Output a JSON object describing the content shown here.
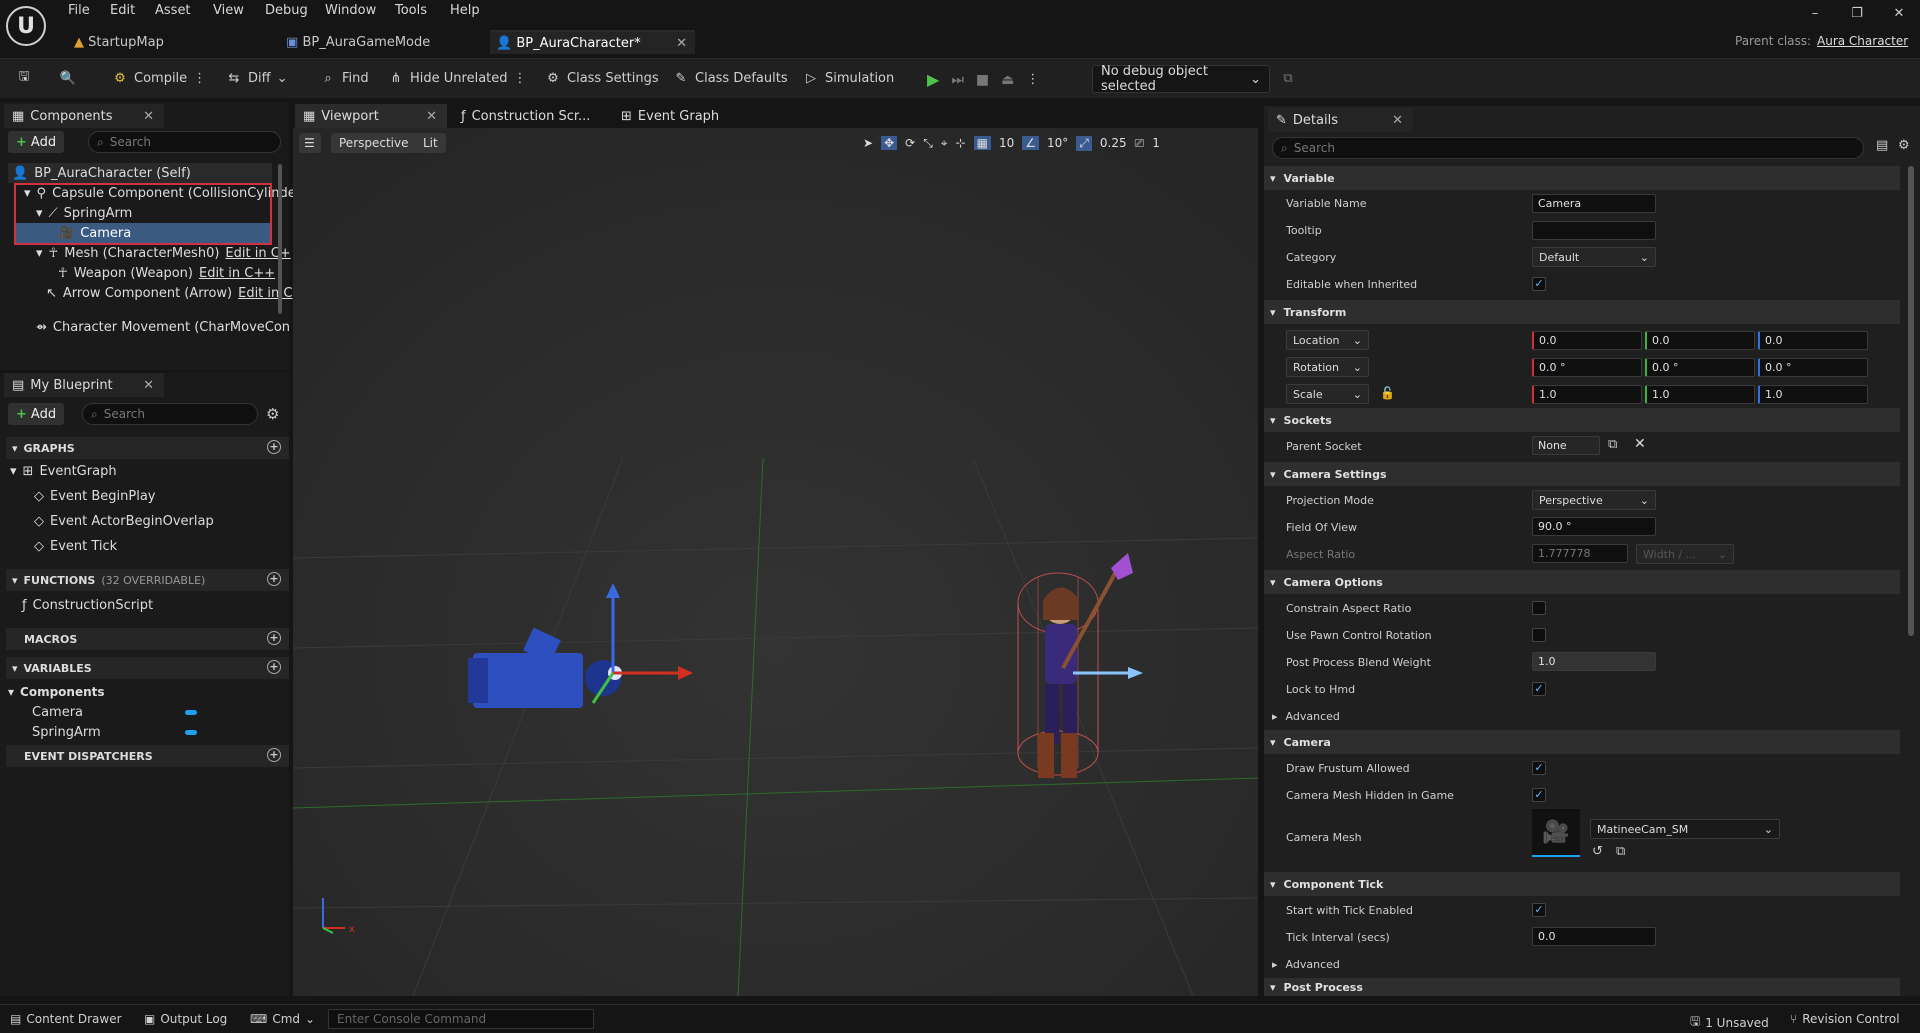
{
  "menu": [
    "File",
    "Edit",
    "Asset",
    "View",
    "Debug",
    "Window",
    "Tools",
    "Help"
  ],
  "doc_tabs": [
    {
      "label": "StartupMap",
      "active": false
    },
    {
      "label": "BP_AuraGameMode",
      "active": false
    },
    {
      "label": "BP_AuraCharacter*",
      "active": true
    }
  ],
  "parent_class": {
    "label": "Parent class:",
    "value": "Aura Character"
  },
  "window_buttons": [
    "–",
    "❐",
    "✕"
  ],
  "toolbar": {
    "compile": "Compile",
    "diff": "Diff",
    "find": "Find",
    "hide_unrelated": "Hide Unrelated",
    "class_settings": "Class Settings",
    "class_defaults": "Class Defaults",
    "simulation": "Simulation",
    "debug_object": "No debug object selected"
  },
  "components_panel": {
    "tab": "Components",
    "add": "Add",
    "search_placeholder": "Search",
    "tree": [
      {
        "label": "BP_AuraCharacter (Self)",
        "edit": ""
      },
      {
        "label": "Capsule Component (CollisionCylinde",
        "edit": ""
      },
      {
        "label": "SpringArm",
        "edit": ""
      },
      {
        "label": "Camera",
        "edit": ""
      },
      {
        "label": "Mesh (CharacterMesh0)",
        "edit": "Edit in C+"
      },
      {
        "label": "Weapon (Weapon)",
        "edit": "Edit in C++"
      },
      {
        "label": "Arrow Component (Arrow)",
        "edit": "Edit in C"
      },
      {
        "label": "Character Movement (CharMoveCon",
        "edit": ""
      }
    ]
  },
  "my_blueprint": {
    "tab": "My Blueprint",
    "add": "Add",
    "search_placeholder": "Search",
    "graphs_header": "GRAPHS",
    "event_graph": "EventGraph",
    "events": [
      "Event BeginPlay",
      "Event ActorBeginOverlap",
      "Event Tick"
    ],
    "functions_header": "FUNCTIONS",
    "functions_note": "(32 OVERRIDABLE)",
    "construction_script": "ConstructionScript",
    "macros_header": "MACROS",
    "variables_header": "VARIABLES",
    "components_group": "Components",
    "variables": [
      "Camera",
      "SpringArm"
    ],
    "event_dispatchers_header": "EVENT DISPATCHERS"
  },
  "editor_tabs": {
    "viewport": "Viewport",
    "construction": "Construction Scr...",
    "event_graph": "Event Graph"
  },
  "viewport": {
    "perspective": "Perspective",
    "lit": "Lit",
    "grid_snap": "10",
    "rot_snap": "10°",
    "scale_snap": "0.25",
    "cam_speed": "1",
    "axis_x": "x"
  },
  "details": {
    "tab": "Details",
    "search_placeholder": "Search",
    "variable": {
      "header": "Variable",
      "name_label": "Variable Name",
      "name_value": "Camera",
      "tooltip_label": "Tooltip",
      "tooltip_value": "",
      "category_label": "Category",
      "category_value": "Default",
      "editable_label": "Editable when Inherited"
    },
    "transform": {
      "header": "Transform",
      "location": "Location",
      "rotation": "Rotation",
      "scale": "Scale",
      "loc": [
        "0.0",
        "0.0",
        "0.0"
      ],
      "rot": [
        "0.0 °",
        "0.0 °",
        "0.0 °"
      ],
      "scl": [
        "1.0",
        "1.0",
        "1.0"
      ]
    },
    "sockets": {
      "header": "Sockets",
      "parent_label": "Parent Socket",
      "parent_value": "None"
    },
    "camera_settings": {
      "header": "Camera Settings",
      "projection_label": "Projection Mode",
      "projection_value": "Perspective",
      "fov_label": "Field Of View",
      "fov_value": "90.0 °",
      "aspect_label": "Aspect Ratio",
      "aspect_value": "1.777778",
      "aspect_dd": "Width / ..."
    },
    "camera_options": {
      "header": "Camera Options",
      "constrain": "Constrain Aspect Ratio",
      "pawn_rot": "Use Pawn Control Rotation",
      "blend_label": "Post Process Blend Weight",
      "blend_value": "1.0",
      "lock_hmd": "Lock to Hmd",
      "advanced": "Advanced"
    },
    "camera": {
      "header": "Camera",
      "frustum": "Draw Frustum Allowed",
      "mesh_hidden": "Camera Mesh Hidden in Game",
      "mesh_label": "Camera Mesh",
      "mesh_value": "MatineeCam_SM"
    },
    "component_tick": {
      "header": "Component Tick",
      "start_tick": "Start with Tick Enabled",
      "interval_label": "Tick Interval (secs)",
      "interval_value": "0.0",
      "advanced": "Advanced"
    },
    "post_process": {
      "header": "Post Process"
    }
  },
  "statusbar": {
    "content_drawer": "Content Drawer",
    "output_log": "Output Log",
    "cmd": "Cmd",
    "console_placeholder": "Enter Console Command",
    "unsaved": "1 Unsaved",
    "revision": "Revision Control"
  },
  "colors": {
    "accent": "#1ea0f0",
    "play": "#4cc44c",
    "selection": "#3b5a82",
    "highlight_box": "#d03040"
  }
}
